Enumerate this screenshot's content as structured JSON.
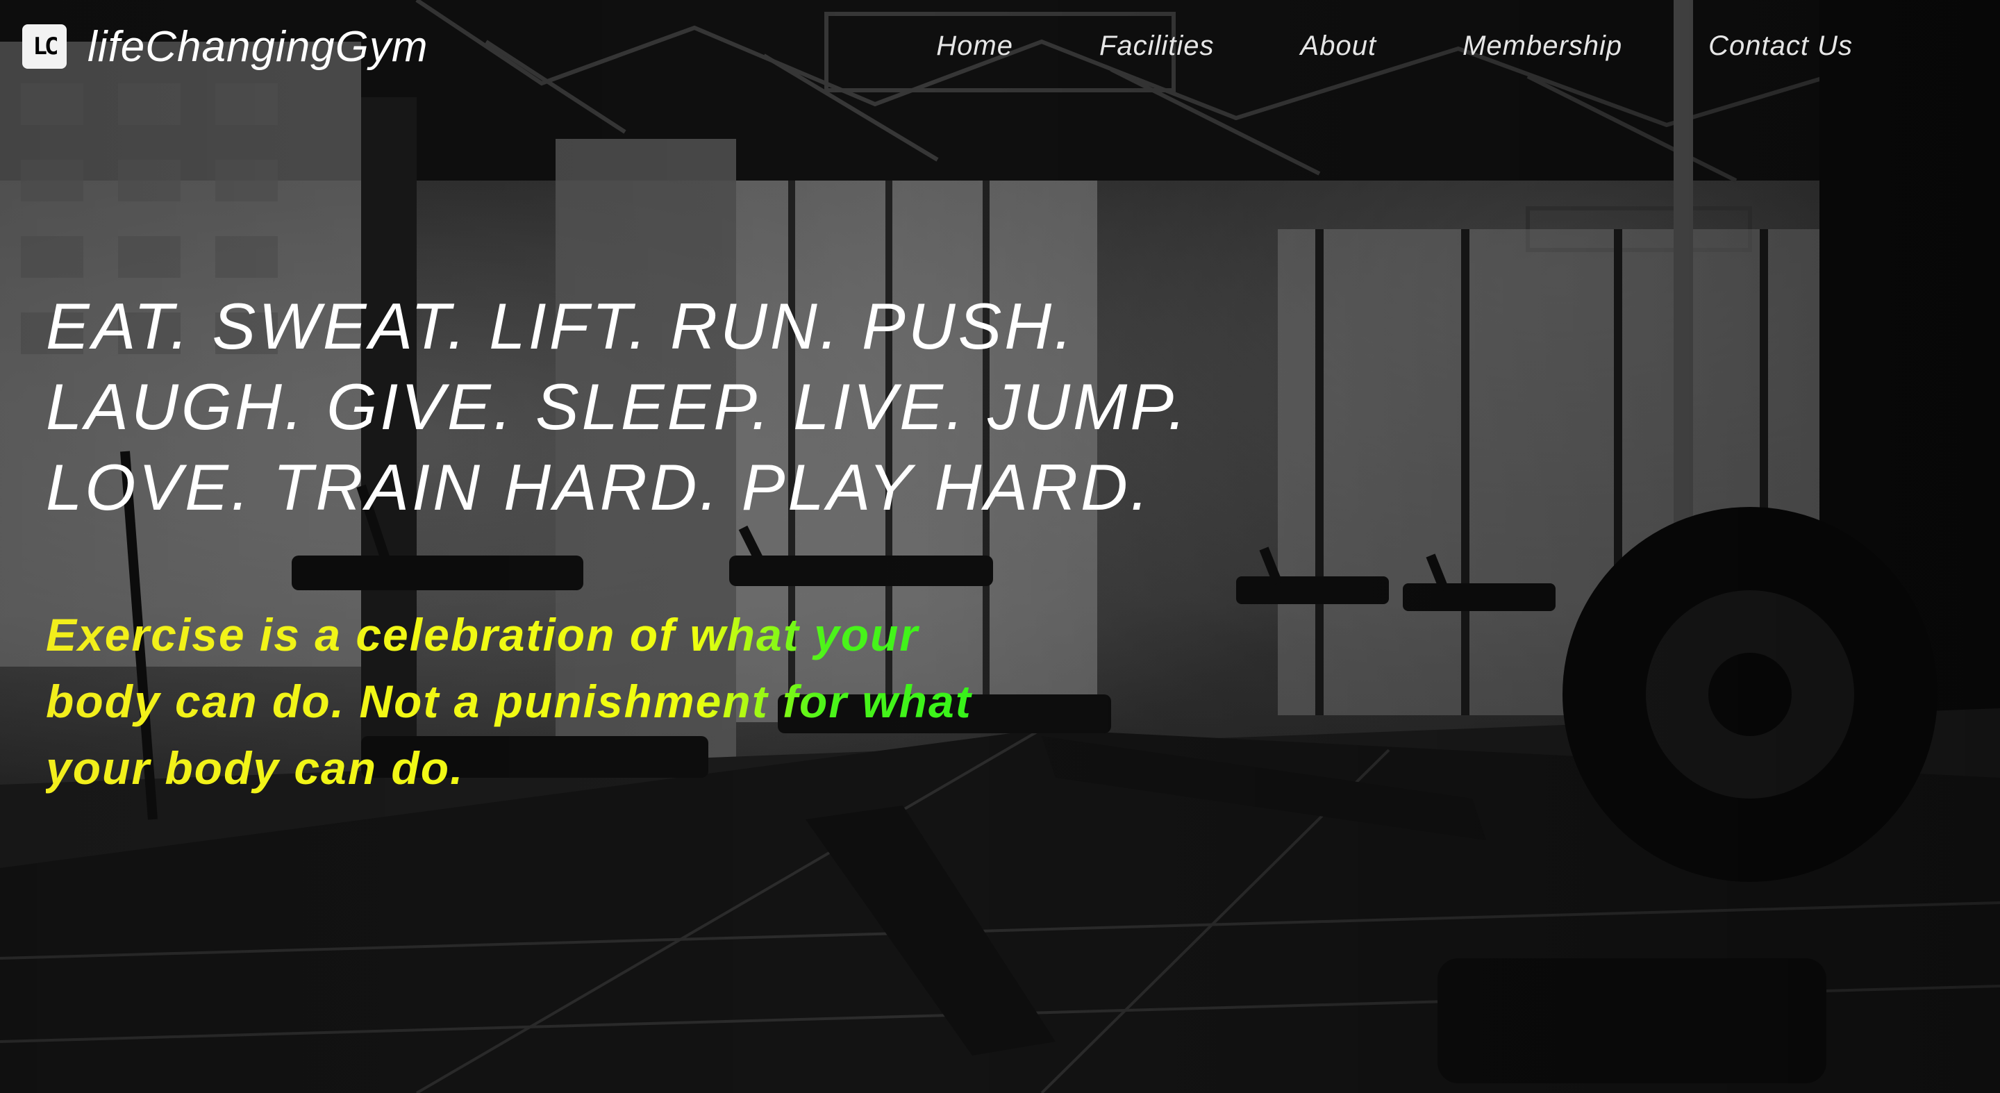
{
  "brand": {
    "logo_text": "LC",
    "name": "lifeChangingGym"
  },
  "nav": {
    "items": [
      {
        "label": "Home"
      },
      {
        "label": "Facilities"
      },
      {
        "label": "About"
      },
      {
        "label": "Membership"
      },
      {
        "label": "Contact Us"
      }
    ]
  },
  "hero": {
    "headline_lines": [
      "EAT. SWEAT. LIFT. RUN. PUSH.",
      "LAUGH. GIVE. SLEEP. LIVE. JUMP.",
      "LOVE. TRAIN HARD. PLAY HARD."
    ],
    "quote_lines": [
      "Exercise is a celebration of what your",
      "body can do. Not a punishment for what",
      "your body can do."
    ]
  },
  "colors": {
    "headline": "#ffffff",
    "quote_yellow": "#f2ee1c",
    "quote_green": "#13f01a",
    "nav_text": "#e6e6e6"
  }
}
